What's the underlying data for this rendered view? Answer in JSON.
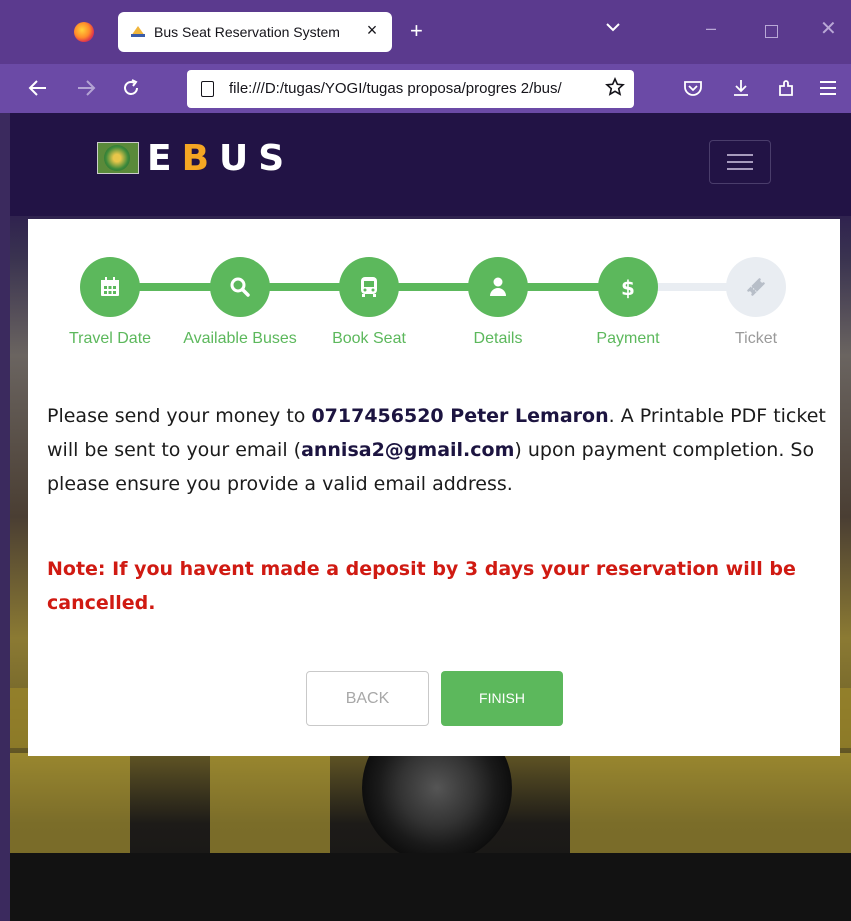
{
  "browser": {
    "tab_title": "Bus Seat Reservation System",
    "tab_close": "×",
    "new_tab": "+",
    "url": "file:///D:/tugas/YOGI/tugas proposa/progres 2/bus/",
    "window_controls": {
      "minimize": "–",
      "close": "✕"
    },
    "icons": [
      "firefox-logo",
      "back-arrow-icon",
      "forward-arrow-icon",
      "reload-icon",
      "page-icon",
      "star-icon",
      "pocket-icon",
      "download-icon",
      "extensions-icon",
      "menu-icon"
    ]
  },
  "header": {
    "brand_parts": [
      "E",
      "B",
      "U",
      "S"
    ],
    "brand_accent_color": "#f5a623"
  },
  "stepper": {
    "active_color": "#5cb85c",
    "inactive_color": "#e9edf2",
    "steps": [
      {
        "label": "Travel Date",
        "icon": "calendar-icon",
        "done": true
      },
      {
        "label": "Available Buses",
        "icon": "search-icon",
        "done": true
      },
      {
        "label": "Book Seat",
        "icon": "bus-icon",
        "done": true
      },
      {
        "label": "Details",
        "icon": "user-icon",
        "done": true
      },
      {
        "label": "Payment",
        "icon": "dollar-icon",
        "done": true
      },
      {
        "label": "Ticket",
        "icon": "ticket-icon",
        "done": false
      }
    ]
  },
  "message": {
    "p1_before": "Please send your money to ",
    "p1_account": "0717456520 Peter Lemaron",
    "p1_middle": ". A Printable PDF ticket will be sent to your email (",
    "p1_email": "annisa2@gmail.com",
    "p1_after": ") upon payment completion. So please ensure you provide a valid email address.",
    "note": "Note: If you havent made a deposit by 3 days your reservation will be cancelled."
  },
  "buttons": {
    "back": "BACK",
    "finish": "FINISH"
  }
}
